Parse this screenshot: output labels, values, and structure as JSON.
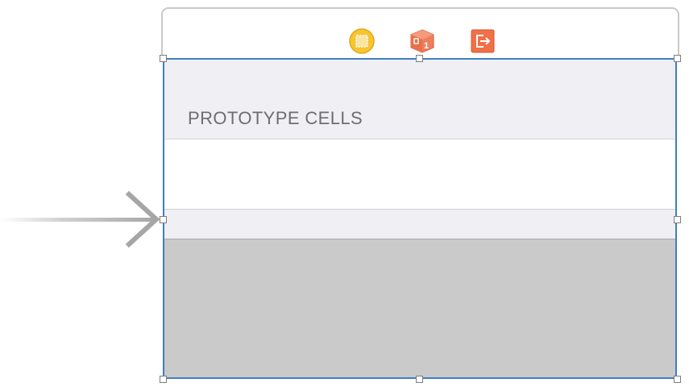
{
  "scene": {
    "section_header": "PROTOTYPE CELLS"
  },
  "scene_dock": {
    "icons": [
      {
        "name": "view-controller-icon",
        "color": "#f7c531"
      },
      {
        "name": "first-responder-icon",
        "color": "#ef7d5b"
      },
      {
        "name": "exit-icon",
        "color": "#f07048"
      }
    ]
  },
  "colors": {
    "selection_border": "#3d7fc1",
    "table_background": "#efeff4",
    "empty_area": "#cacaca",
    "section_text": "#6d6d72"
  }
}
